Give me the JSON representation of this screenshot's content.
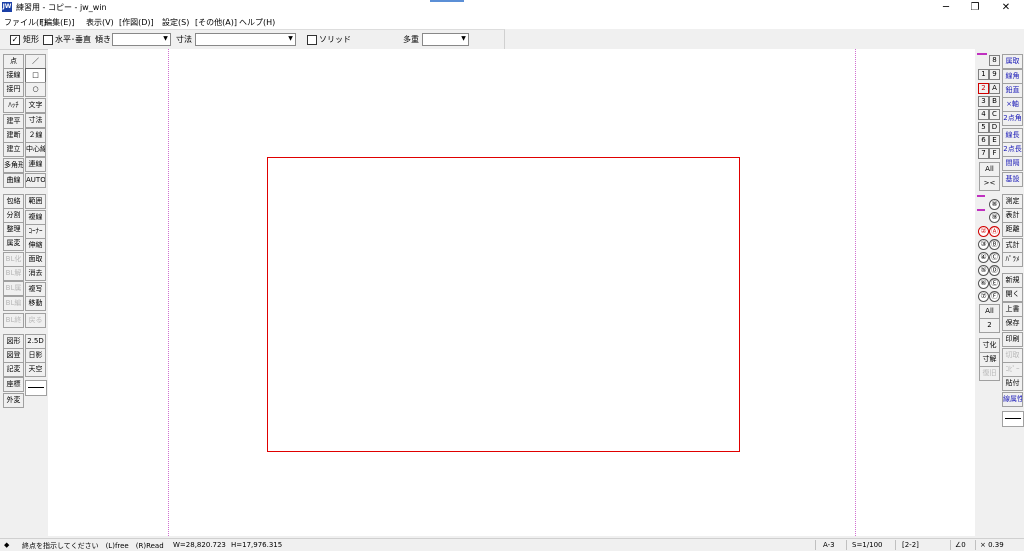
{
  "window": {
    "title": "練習用 - コピー - jw_win",
    "app_icon": "JW",
    "minimize": "─",
    "maximize": "❐",
    "close": "✕"
  },
  "menu": [
    "ファイル(F)",
    "[編集(E)]",
    "表示(V)",
    "[作図(D)]",
    "設定(S)",
    "[その他(A)]",
    "ヘルプ(H)"
  ],
  "propbar": {
    "rect_check": "✓",
    "rect_label": "矩形",
    "hv_label": "水平･垂直",
    "angle_label": "傾き",
    "angle_value": "",
    "dim_label": "寸法",
    "dim_value": "",
    "solid_label": "ソリッド",
    "multi_label": "多重",
    "multi_value": ""
  },
  "left_tools": {
    "col1": [
      "点",
      "接線",
      "接円",
      "ﾊｯﾁ",
      "建平",
      "建断",
      "建立",
      "多角形",
      "曲線",
      "包絡",
      "分割",
      "整理",
      "属変",
      "BL化",
      "BL解",
      "BL属",
      "BL編",
      "BL終",
      "図形",
      "図登",
      "記変",
      "座標",
      "外変"
    ],
    "col2": [
      "／",
      "□",
      "○",
      "文字",
      "寸法",
      "２線",
      "中心線",
      "連線",
      "AUTO",
      "範囲",
      "複線",
      "ｺｰﾅｰ",
      "伸縮",
      "面取",
      "消去",
      "複写",
      "移動",
      "戻る",
      "2.5D",
      "日影",
      "天空"
    ]
  },
  "right_panel": {
    "layer_groups": [
      "8",
      "9",
      "A",
      "B",
      "C",
      "D",
      "E",
      "F"
    ],
    "layer_nums": [
      "1",
      "2",
      "3",
      "4",
      "5",
      "6",
      "7"
    ],
    "all_label": "All",
    "cross_label": "><",
    "layers_top": [
      "⑧",
      "⑨"
    ],
    "layers_a": [
      "②",
      "③",
      "④",
      "⑤",
      "⑥",
      "⑦"
    ],
    "layers_b": [
      "Ⓐ",
      "Ⓑ",
      "Ⓒ",
      "Ⓓ",
      "Ⓔ",
      "Ⓕ"
    ],
    "all2_label": "All",
    "two_label": "2",
    "misc": [
      "寸化",
      "寸解",
      "復旧"
    ],
    "tools": [
      "属取",
      "線角",
      "鉛直",
      "×軸",
      "2点角",
      "線長",
      "2点長",
      "間隔",
      "基設",
      "測定",
      "表計",
      "距離",
      "式計",
      "ﾊﾟﾗﾒ",
      "新規",
      "開く",
      "上書",
      "保存",
      "印刷",
      "切取",
      "ｺﾋﾟｰ",
      "貼付",
      "線属性"
    ]
  },
  "status": {
    "icon": "◆",
    "message": "終点を指示してください　(L)free　(R)Read",
    "width": "W=28,820.723",
    "height": "H=17,976.315",
    "paper": "A-3",
    "scale": "S=1/100",
    "layer": "[2-2]",
    "angle": "∠0",
    "factor": "× 0.39"
  }
}
